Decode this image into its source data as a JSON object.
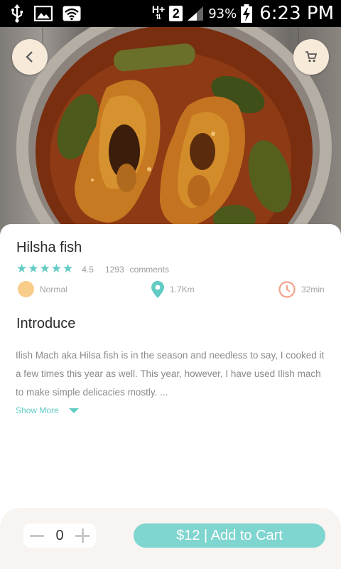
{
  "status_bar": {
    "battery_percent": "93%",
    "time": "6:23 PM",
    "network_label": "H+",
    "sim_slot": "2",
    "icons": [
      "usb-icon",
      "image-icon",
      "wifi-icon",
      "network-type-icon",
      "sim-icon",
      "signal-icon",
      "battery-charging-icon"
    ]
  },
  "header": {
    "back_icon": "chevron-left-icon",
    "cart_icon": "cart-icon"
  },
  "dish": {
    "name": "Hilsha fish",
    "rating": "4.5",
    "rating_stars": 5,
    "comments_count": "1293",
    "comments_label": "comments"
  },
  "info": {
    "level": "Normal",
    "distance": "1.7Km",
    "time": "32min",
    "icons": [
      "level-dot-icon",
      "location-pin-icon",
      "clock-icon"
    ]
  },
  "introduce": {
    "title": "Introduce",
    "text": "Ilish Mach aka Hilsa fish is in the season and needless to say, I cooked it a few times this year as well. This year, however, I have used Ilish mach to make simple delicacies mostly. ...",
    "show_more": "Show More"
  },
  "cart": {
    "quantity": "0",
    "add_label": "$12 | Add to Cart"
  },
  "colors": {
    "accent": "#62cbc4",
    "button": "#7fd5cf",
    "level_dot": "#f8cd8a",
    "clock": "#f4a38a",
    "circle_btn": "#f7ead9"
  }
}
